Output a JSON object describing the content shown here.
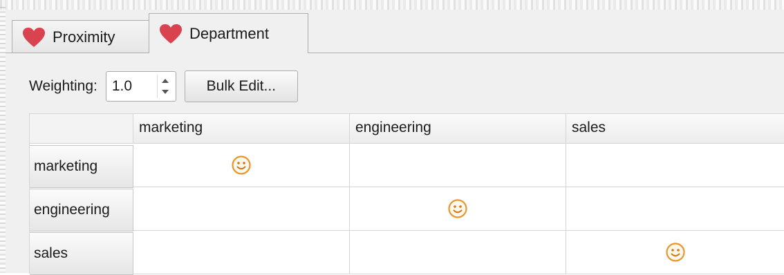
{
  "tabs": [
    {
      "label": "Proximity",
      "icon": "heart-icon",
      "active": false
    },
    {
      "label": "Department",
      "icon": "heart-icon",
      "active": true
    }
  ],
  "toolbar": {
    "weighting_label": "Weighting:",
    "weighting_value": "1.0",
    "bulk_edit_label": "Bulk Edit..."
  },
  "grid": {
    "columns": [
      "marketing",
      "engineering",
      "sales"
    ],
    "rows": [
      {
        "label": "marketing",
        "cells": [
          "smiley-icon",
          "",
          ""
        ]
      },
      {
        "label": "engineering",
        "cells": [
          "",
          "smiley-icon",
          ""
        ]
      },
      {
        "label": "sales",
        "cells": [
          "",
          "",
          "smiley-icon"
        ]
      }
    ]
  },
  "colors": {
    "heart": "#d9434f",
    "smiley": "#e8962d",
    "panel_bg": "#f0f0f0",
    "grid_line": "#d5d5d5"
  }
}
